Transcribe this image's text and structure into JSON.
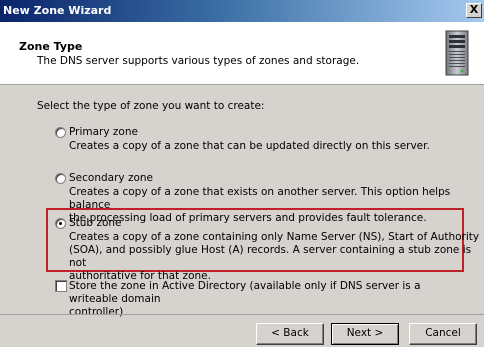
{
  "window": {
    "title": "New Zone Wizard",
    "close_glyph": "X"
  },
  "header": {
    "title": "Zone Type",
    "subtitle": "The DNS server supports various types of zones and storage.",
    "icon": "server-icon"
  },
  "prompt": "Select the type of zone you want to create:",
  "options": [
    {
      "label": "Primary zone",
      "lines": [
        "Creates a copy of a zone that can be updated directly on this server."
      ],
      "selected": false
    },
    {
      "label": "Secondary zone",
      "lines": [
        "Creates a copy of a zone that exists on another server. This option helps balance",
        "the processing load of primary servers and provides fault tolerance."
      ],
      "selected": false
    },
    {
      "label": "Stub zone",
      "lines": [
        "Creates a copy of a zone containing only Name Server (NS), Start of Authority",
        "(SOA), and possibly glue Host (A) records. A server containing a stub zone is not",
        "authoritative for that zone."
      ],
      "selected": true
    }
  ],
  "ad_checkbox": {
    "lines": [
      "Store the zone in Active Directory (available only if DNS server is a writeable domain",
      "controller)"
    ],
    "checked": false
  },
  "buttons": {
    "back": "< Back",
    "next": "Next >",
    "cancel": "Cancel"
  },
  "colors": {
    "highlight": "#c0202a",
    "dialog_bg": "#d6d3ce",
    "title_start": "#0a246a"
  }
}
